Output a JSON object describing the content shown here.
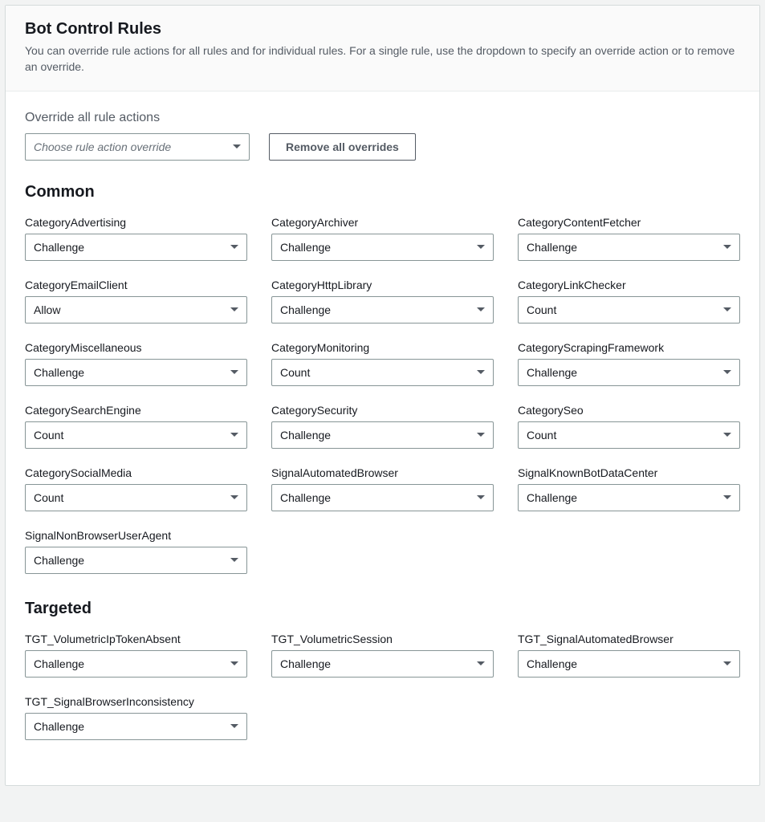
{
  "header": {
    "title": "Bot Control Rules",
    "description": "You can override rule actions for all rules and for individual rules. For a single rule, use the dropdown to specify an override action or to remove an override."
  },
  "override": {
    "label": "Override all rule actions",
    "placeholder": "Choose rule action override",
    "remove_button": "Remove all overrides"
  },
  "groups": [
    {
      "title": "Common",
      "rules": [
        {
          "name": "CategoryAdvertising",
          "value": "Challenge"
        },
        {
          "name": "CategoryArchiver",
          "value": "Challenge"
        },
        {
          "name": "CategoryContentFetcher",
          "value": "Challenge"
        },
        {
          "name": "CategoryEmailClient",
          "value": "Allow"
        },
        {
          "name": "CategoryHttpLibrary",
          "value": "Challenge"
        },
        {
          "name": "CategoryLinkChecker",
          "value": "Count"
        },
        {
          "name": "CategoryMiscellaneous",
          "value": "Challenge"
        },
        {
          "name": "CategoryMonitoring",
          "value": "Count"
        },
        {
          "name": "CategoryScrapingFramework",
          "value": "Challenge"
        },
        {
          "name": "CategorySearchEngine",
          "value": "Count"
        },
        {
          "name": "CategorySecurity",
          "value": "Challenge"
        },
        {
          "name": "CategorySeo",
          "value": "Count"
        },
        {
          "name": "CategorySocialMedia",
          "value": "Count"
        },
        {
          "name": "SignalAutomatedBrowser",
          "value": "Challenge"
        },
        {
          "name": "SignalKnownBotDataCenter",
          "value": "Challenge"
        },
        {
          "name": "SignalNonBrowserUserAgent",
          "value": "Challenge"
        }
      ]
    },
    {
      "title": "Targeted",
      "rules": [
        {
          "name": "TGT_VolumetricIpTokenAbsent",
          "value": "Challenge"
        },
        {
          "name": "TGT_VolumetricSession",
          "value": "Challenge"
        },
        {
          "name": "TGT_SignalAutomatedBrowser",
          "value": "Challenge"
        },
        {
          "name": "TGT_SignalBrowserInconsistency",
          "value": "Challenge"
        }
      ]
    }
  ]
}
